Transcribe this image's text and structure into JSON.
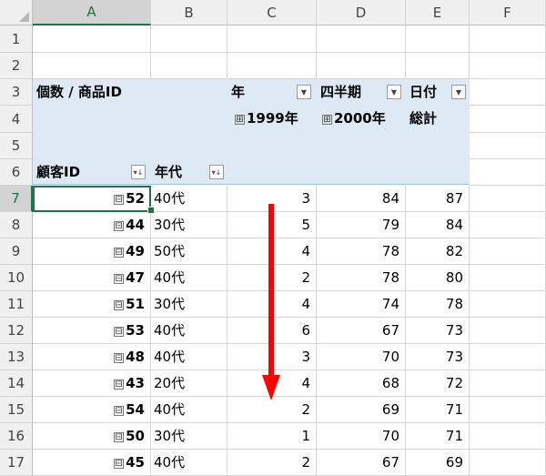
{
  "columns": [
    "A",
    "B",
    "C",
    "D",
    "E",
    "F"
  ],
  "selected_column": "A",
  "selected_row": 7,
  "row_numbers": [
    1,
    2,
    3,
    4,
    5,
    6,
    7,
    8,
    9,
    10,
    11,
    12,
    13,
    14,
    15,
    16,
    17
  ],
  "pivot": {
    "data_label": "個数 / 商品ID",
    "year_label": "年",
    "quarter_label": "四半期",
    "date_label": "日付",
    "year_1999": "1999年",
    "year_2000": "2000年",
    "total_label": "総計",
    "customer_label": "顧客ID",
    "age_label": "年代",
    "expand_symbol": "⊞",
    "collapse_symbol": "⊟",
    "rows": [
      {
        "id": "52",
        "age": "40代",
        "y1999": "3",
        "y2000": "84",
        "total": "87"
      },
      {
        "id": "44",
        "age": "30代",
        "y1999": "5",
        "y2000": "79",
        "total": "84"
      },
      {
        "id": "49",
        "age": "50代",
        "y1999": "4",
        "y2000": "78",
        "total": "82"
      },
      {
        "id": "47",
        "age": "40代",
        "y1999": "2",
        "y2000": "78",
        "total": "80"
      },
      {
        "id": "51",
        "age": "30代",
        "y1999": "4",
        "y2000": "74",
        "total": "78"
      },
      {
        "id": "53",
        "age": "40代",
        "y1999": "6",
        "y2000": "67",
        "total": "73"
      },
      {
        "id": "48",
        "age": "40代",
        "y1999": "3",
        "y2000": "70",
        "total": "73"
      },
      {
        "id": "43",
        "age": "20代",
        "y1999": "4",
        "y2000": "68",
        "total": "72"
      },
      {
        "id": "54",
        "age": "40代",
        "y1999": "2",
        "y2000": "69",
        "total": "71"
      },
      {
        "id": "50",
        "age": "30代",
        "y1999": "1",
        "y2000": "70",
        "total": "71"
      },
      {
        "id": "45",
        "age": "40代",
        "y1999": "2",
        "y2000": "67",
        "total": "69"
      }
    ]
  },
  "colors": {
    "accent": "#217346",
    "pivot_fill": "#dde9f5",
    "arrow": "#ff0000"
  }
}
